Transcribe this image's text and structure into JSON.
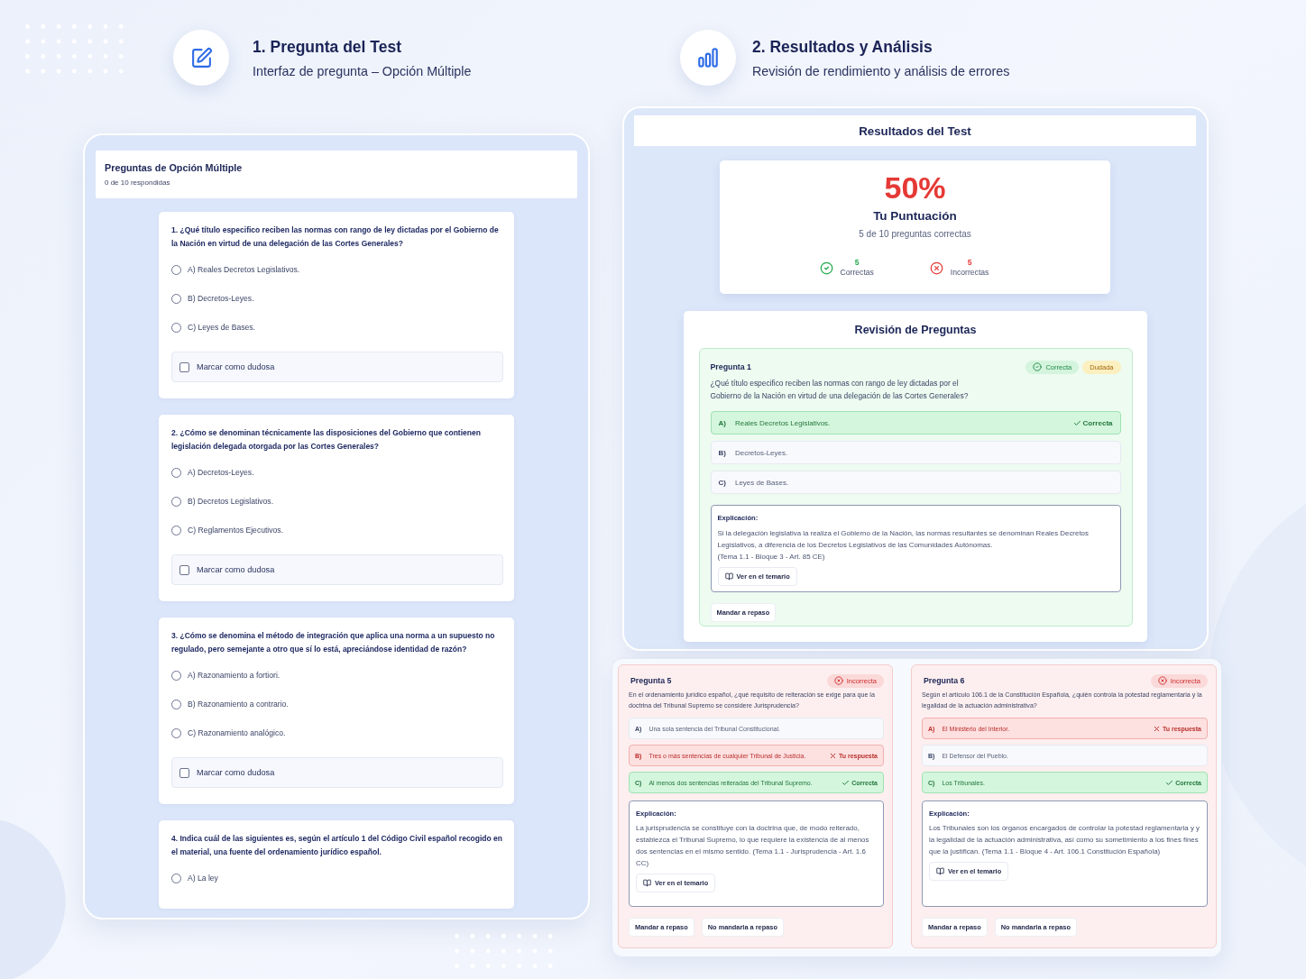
{
  "test_panel": {
    "header": {
      "title": "1. Pregunta del Test",
      "subtitle": "Interfaz de pregunta – Opción Múltiple"
    },
    "title": "Preguntas de Opción Múltiple",
    "progress": "0 de 10 respondidas",
    "questions": [
      {
        "text": "1. ¿Qué título especifico reciben las normas con rango de ley dictadas por el Gobierno de la Nación en virtud de una delegación de las Cortes Generales?",
        "options": [
          {
            "label": "A) Reales Decretos Legislativos.",
            "selected": false
          },
          {
            "label": "B) Decretos-Leyes.",
            "selected": false
          },
          {
            "label": "C) Leyes de Bases.",
            "selected": false
          }
        ],
        "doubt": {
          "label": "Marcar como dudosa",
          "checked": false
        }
      },
      {
        "text": "2. ¿Cómo se denominan técnicamente las disposiciones del Gobierno que contienen legislación delegada otorgada por las Cortes Generales?",
        "options": [
          {
            "label": "A) Decretos-Leyes.",
            "selected": false
          },
          {
            "label": "B) Decretos Legislativos.",
            "selected": false
          },
          {
            "label": "C) Reglamentos Ejecutivos.",
            "selected": false
          }
        ],
        "doubt": {
          "label": "Marcar como dudosa",
          "checked": false
        }
      },
      {
        "text": "3. ¿Cómo se denomina el método de integración que aplica una norma a un supuesto no regulado, pero semejante a otro que sí lo está, apreciándose identidad de razón?",
        "options": [
          {
            "label": "A) Razonamiento a fortiori.",
            "selected": false
          },
          {
            "label": "B) Razonamiento a contrario.",
            "selected": false
          },
          {
            "label": "C) Razonamiento analógico.",
            "selected": false
          }
        ],
        "doubt": {
          "label": "Marcar como dudosa",
          "checked": false
        }
      },
      {
        "text": "4. Indica cuál de las siguientes es, según el artículo 1 del Código Civil español recogido en el material, una fuente del ordenamiento jurídico español.",
        "options": [
          {
            "label": "A) La ley",
            "selected": false
          }
        ]
      }
    ]
  },
  "results_panel": {
    "header": {
      "title": "2. Resultados y Análisis",
      "subtitle": "Revisión de rendimiento y análisis de errores"
    },
    "title": "Resultados del Test",
    "score": {
      "value": "50%",
      "label": "Tu Puntuación",
      "summary": "5 de 10 preguntas correctas",
      "stats": [
        {
          "kind": "correct",
          "count": "5",
          "label": "Correctas"
        },
        {
          "kind": "incorrect",
          "count": "5",
          "label": "Incorrectas"
        }
      ]
    },
    "review": {
      "title": "Revisión de Preguntas",
      "questions": [
        {
          "title": "Pregunta 1",
          "kind": "correct",
          "badges": [
            {
              "kind": "correct",
              "label": "Correcta"
            },
            {
              "kind": "doubt",
              "label": "Dudada"
            }
          ],
          "text": "¿Qué título especifico reciben las normas con rango de ley dictadas por el Gobierno de la Nación en virtud de una delegación de las Cortes Generales?",
          "options": [
            {
              "letter": "A)",
              "text": "Reales Decretos Legislativos.",
              "kind": "correct",
              "tag": "Correcta"
            },
            {
              "letter": "B)",
              "text": "Decretos-Leyes.",
              "kind": "neutral"
            },
            {
              "letter": "C)",
              "text": "Leyes de Bases.",
              "kind": "neutral"
            }
          ],
          "explanation": {
            "title": "Explicación:",
            "paragraphs": [
              "Si la delegación legislativa la realiza el Gobierno de la Nación, las normas resultantes se denominan Reales Decretos Legislativos, a diferencia de los Decretos Legislativos de las Comunidades Autónomas.",
              "(Tema 1.1 - Bloque 3 - Art. 85 CE)"
            ],
            "link": "Ver en el temario"
          },
          "actions": [
            "Mandar a repaso"
          ]
        }
      ]
    }
  },
  "detail_panel": {
    "questions": [
      {
        "title": "Pregunta 5",
        "kind": "incorrect",
        "badges": [
          {
            "kind": "incorrect",
            "label": "Incorrecta"
          }
        ],
        "text": "En el ordenamiento jurídico español, ¿qué requisito de reiteración se exige para que la doctrina del Tribunal Supremo se considere Jurisprudencia?",
        "options": [
          {
            "letter": "A)",
            "text": "Una sola sentencia del Tribunal Constitucional.",
            "kind": "neutral"
          },
          {
            "letter": "B)",
            "text": "Tres o más sentencias de cualquier Tribunal de Justicia.",
            "kind": "wrong",
            "tag": "Tu respuesta"
          },
          {
            "letter": "C)",
            "text": "Al menos dos sentencias reiteradas del Tribunal Supremo.",
            "kind": "correct",
            "tag": "Correcta"
          }
        ],
        "explanation": {
          "title": "Explicación:",
          "paragraphs": [
            "La jurisprudencia se constituye con la doctrina que, de modo reiterado, establezca el Tribunal Supremo, lo que requiere la existencia de al menos dos sentencias en el mismo sentido. (Tema 1.1 - Jurisprudencia - Art. 1.6 CC)"
          ],
          "link": "Ver en el temario"
        },
        "actions": [
          "Mandar a repaso",
          "No mandarla a repaso"
        ]
      },
      {
        "title": "Pregunta 6",
        "kind": "incorrect",
        "badges": [
          {
            "kind": "incorrect",
            "label": "Incorrecta"
          }
        ],
        "text": "Según el artículo 106.1 de la Constitución Española, ¿quién controla la potestad reglamentaria y la legalidad de la actuación administrativa?",
        "options": [
          {
            "letter": "A)",
            "text": "El Ministerio del Interior.",
            "kind": "wrong",
            "tag": "Tu respuesta"
          },
          {
            "letter": "B)",
            "text": "El Defensor del Pueblo.",
            "kind": "neutral"
          },
          {
            "letter": "C)",
            "text": "Los Tribunales.",
            "kind": "correct",
            "tag": "Correcta"
          }
        ],
        "explanation": {
          "title": "Explicación:",
          "paragraphs": [
            "Los Tribunales son los órganos encargados de controlar la potestad reglamentaria y y la legalidad de la actuación administrativa, así como su sometimiento a los fines fines que la justifican. (Tema 1.1 - Bloque 4 - Art. 106.1 Constitución Española)"
          ],
          "link": "Ver en el temario"
        },
        "actions": [
          "Mandar a repaso",
          "No mandarla a repaso"
        ]
      }
    ]
  }
}
